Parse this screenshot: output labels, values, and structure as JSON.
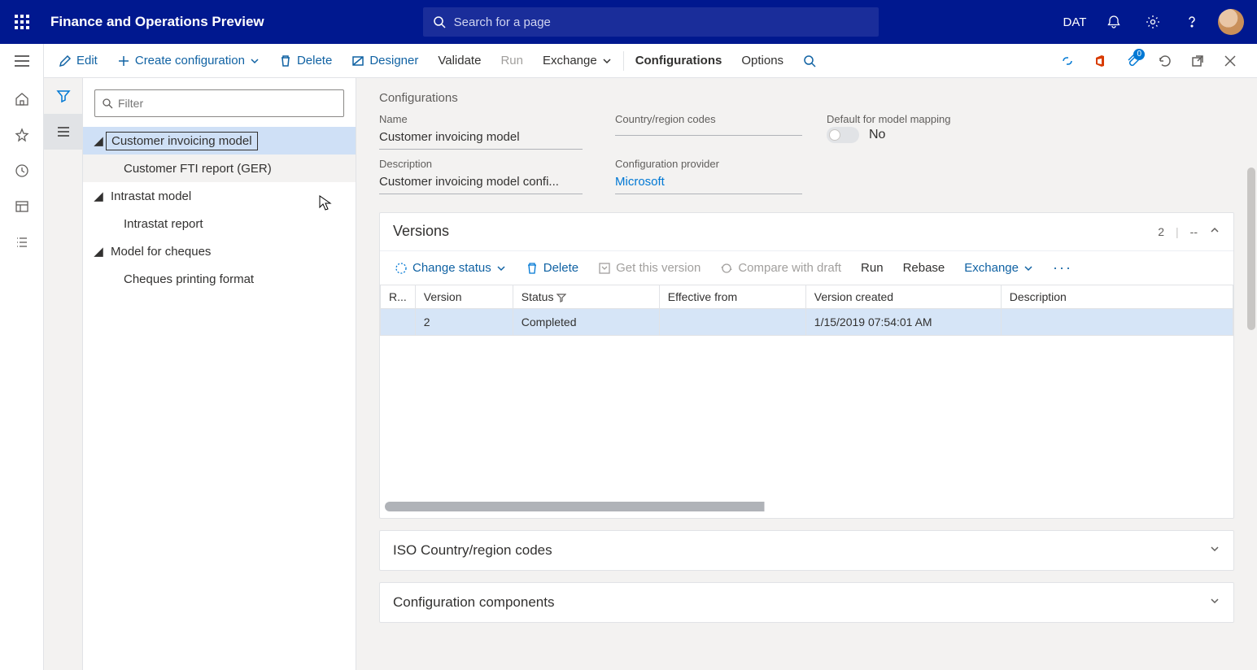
{
  "header": {
    "app_title": "Finance and Operations Preview",
    "search_placeholder": "Search for a page",
    "company": "DAT"
  },
  "toolbar": {
    "edit": "Edit",
    "create": "Create configuration",
    "delete": "Delete",
    "designer": "Designer",
    "validate": "Validate",
    "run": "Run",
    "exchange": "Exchange",
    "configurations": "Configurations",
    "options": "Options",
    "attach_badge": "0"
  },
  "tree": {
    "filter_placeholder": "Filter",
    "items": [
      {
        "label": "Customer invoicing model",
        "expanded": true,
        "selected": true,
        "children": [
          {
            "label": "Customer FTI report (GER)"
          }
        ]
      },
      {
        "label": "Intrastat model",
        "expanded": true,
        "children": [
          {
            "label": "Intrastat report"
          }
        ]
      },
      {
        "label": "Model for cheques",
        "expanded": true,
        "children": [
          {
            "label": "Cheques printing format"
          }
        ]
      }
    ]
  },
  "main": {
    "page_title": "Configurations",
    "fields": {
      "name_label": "Name",
      "name_value": "Customer invoicing model",
      "country_label": "Country/region codes",
      "country_value": "",
      "default_label": "Default for model mapping",
      "default_value": "No",
      "desc_label": "Description",
      "desc_value": "Customer invoicing model confi...",
      "provider_label": "Configuration provider",
      "provider_value": "Microsoft"
    },
    "versions": {
      "title": "Versions",
      "count": "2",
      "dash": "--",
      "toolbar": {
        "change_status": "Change status",
        "delete": "Delete",
        "get_version": "Get this version",
        "compare": "Compare with draft",
        "run": "Run",
        "rebase": "Rebase",
        "exchange": "Exchange"
      },
      "columns": {
        "r": "R...",
        "version": "Version",
        "status": "Status",
        "effective": "Effective from",
        "created": "Version created",
        "description": "Description"
      },
      "rows": [
        {
          "version": "2",
          "status": "Completed",
          "effective": "",
          "created": "1/15/2019 07:54:01 AM",
          "description": ""
        }
      ]
    },
    "sections": {
      "iso": "ISO Country/region codes",
      "components": "Configuration components"
    }
  }
}
